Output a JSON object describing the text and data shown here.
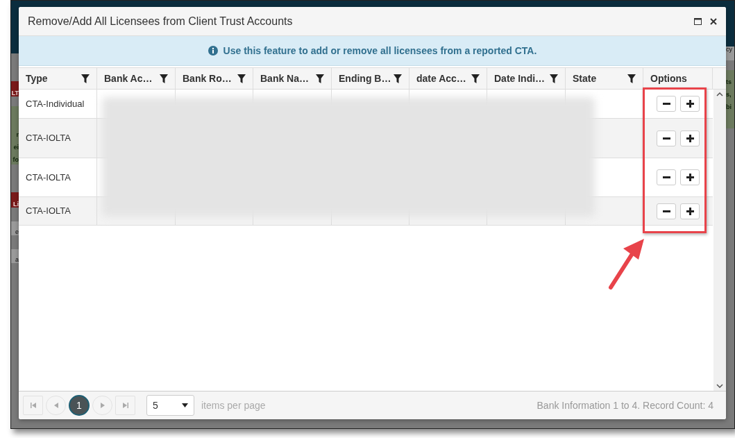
{
  "backdrop": {
    "left": [
      {
        "kind": "banner",
        "text": "LT"
      },
      {
        "kind": "note",
        "lines": [
          "r",
          "ei",
          "fo"
        ]
      },
      {
        "kind": "banner",
        "text": "Li"
      },
      {
        "kind": "plain",
        "text": "e"
      },
      {
        "kind": "plain",
        "text": "a"
      }
    ],
    "right": [
      {
        "kind": "plain",
        "text": "cy"
      },
      {
        "kind": "note",
        "lines": [
          "ts",
          "s,",
          "bi"
        ]
      }
    ]
  },
  "dialog": {
    "title": "Remove/Add All Licensees from Client Trust Accounts",
    "info": "Use this feature to add or remove all licensees from a reported CTA.",
    "table": {
      "columns": [
        {
          "label": "Type",
          "filter": true
        },
        {
          "label": "Bank Ac…",
          "filter": true
        },
        {
          "label": "Bank Ro…",
          "filter": true
        },
        {
          "label": "Bank Na…",
          "filter": true
        },
        {
          "label": "Ending B…",
          "filter": true
        },
        {
          "label": "date Acc…",
          "filter": true
        },
        {
          "label": "Date Indi…",
          "filter": true
        },
        {
          "label": "State",
          "filter": true
        },
        {
          "label": "Options",
          "filter": false
        }
      ],
      "rows": [
        {
          "type": "CTA-Individual"
        },
        {
          "type": "CTA-IOLTA"
        },
        {
          "type": "CTA-IOLTA"
        },
        {
          "type": "CTA-IOLTA"
        }
      ]
    },
    "pager": {
      "pages": [
        {
          "label": "1",
          "selected": true
        }
      ],
      "page_size": "5",
      "page_size_label": "items per page",
      "summary": "Bank Information 1 to 4. Record Count: 4"
    }
  }
}
